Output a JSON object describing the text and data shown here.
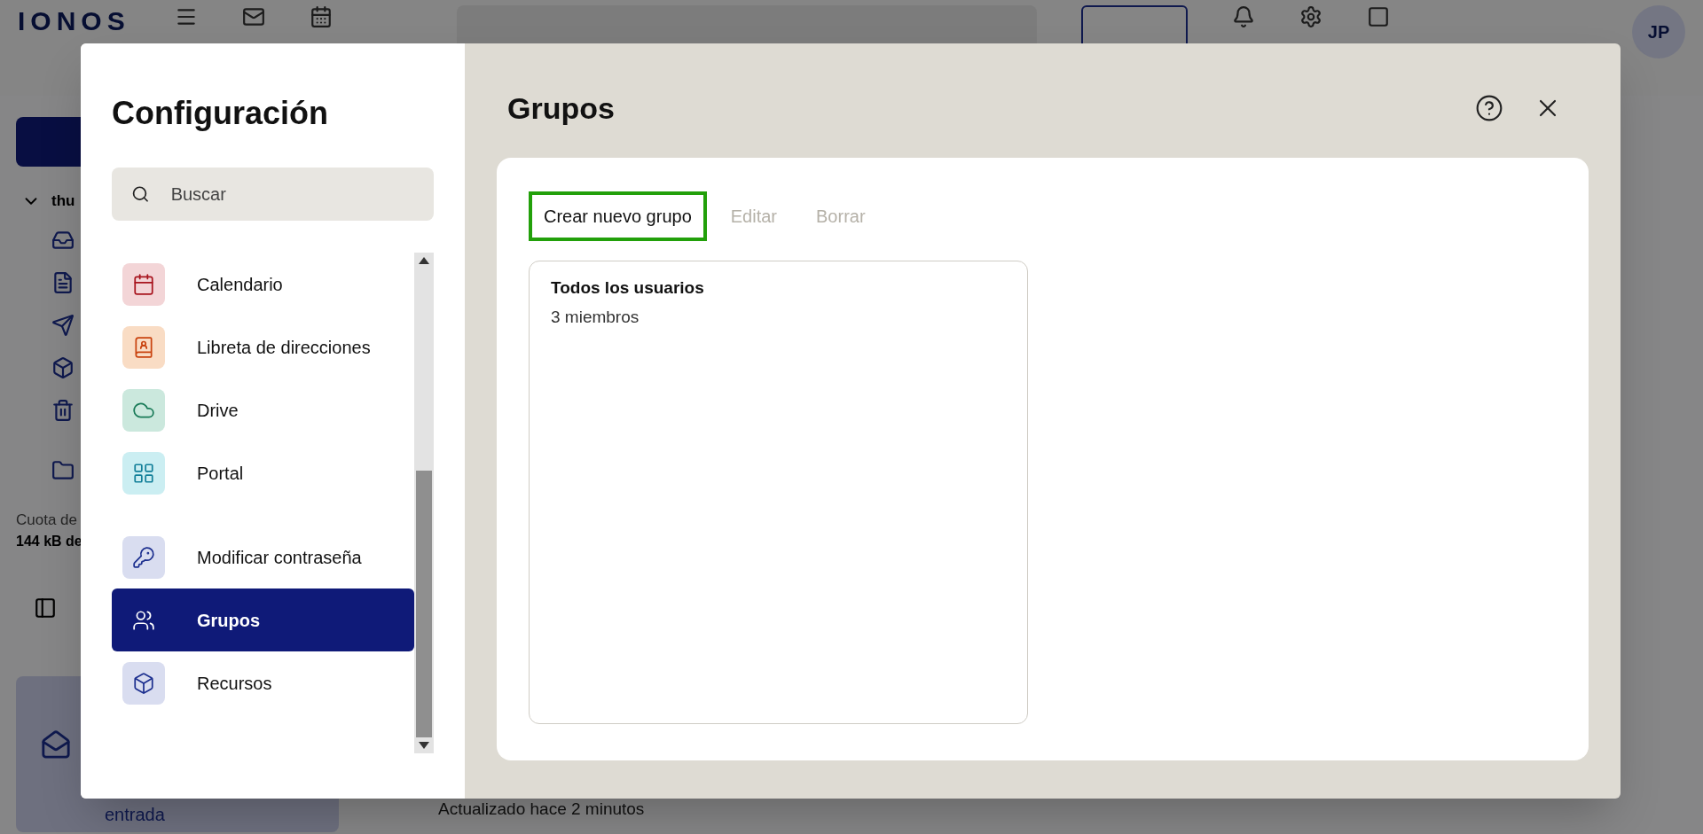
{
  "background_app": {
    "logo": "IONOS",
    "account_name": "thu",
    "quota_label": "Cuota de",
    "quota_value": "144 kB de",
    "promo_text": "entrada",
    "status_text": "Actualizado hace 2 minutos",
    "avatar": "JP"
  },
  "dialog": {
    "title": "Configuración",
    "search": {
      "placeholder": "Buscar"
    },
    "nav_sections": [
      [
        {
          "label": "Calendario",
          "kind": "calendar",
          "color": "#f3d5d7",
          "selected": false
        },
        {
          "label": "Libreta de direcciones",
          "kind": "contacts",
          "color": "#f9dcc4",
          "selected": false
        },
        {
          "label": "Drive",
          "kind": "cloud",
          "color": "#cbe8dd",
          "selected": false
        },
        {
          "label": "Portal",
          "kind": "grid",
          "color": "#cbeef2",
          "selected": false
        }
      ],
      [
        {
          "label": "Modificar contraseña",
          "kind": "key",
          "color": "#d9ddf0",
          "selected": false
        },
        {
          "label": "Grupos",
          "kind": "users",
          "selected": true
        },
        {
          "label": "Recursos",
          "kind": "box",
          "color": "#d9ddf0",
          "selected": false
        }
      ]
    ],
    "section_title": "Grupos",
    "toolbar": [
      {
        "label": "Crear nuevo grupo",
        "disabled": false,
        "highlighted": true
      },
      {
        "label": "Editar",
        "disabled": true,
        "highlighted": false
      },
      {
        "label": "Borrar",
        "disabled": true,
        "highlighted": false
      }
    ],
    "groups": [
      {
        "name": "Todos los usuarios",
        "members": "3 miembros"
      }
    ]
  }
}
